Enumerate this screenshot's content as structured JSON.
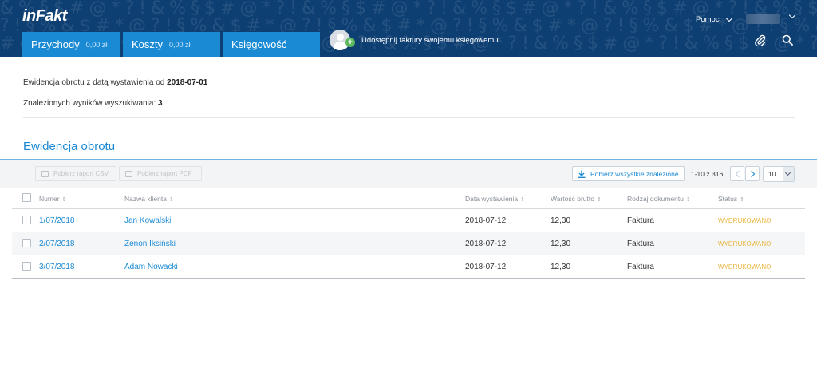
{
  "app": {
    "logo": "inFakt",
    "help_label": "Pomoc",
    "share_text": "Udostępnij faktury swojemu księgowemu"
  },
  "tabs": [
    {
      "label": "Przychody",
      "amount": "0,00 zł"
    },
    {
      "label": "Koszty",
      "amount": "0,00 zł"
    },
    {
      "label": "Księgowość",
      "amount": ""
    }
  ],
  "summary": {
    "filter_prefix": "Ewidencja obrotu z datą wystawienia od ",
    "filter_date": "2018-07-01",
    "results_prefix": "Znalezionych wyników wyszukiwania: ",
    "results_count": "3"
  },
  "section": {
    "title": "Ewidencja obrotu"
  },
  "toolbar": {
    "csv_label": "Pobierz raport CSV",
    "pdf_label": "Pobierz raport PDF",
    "download_all_label": "Pobierz wszystkie znalezione",
    "pager_text": "1-10 z 316",
    "per_page": "10"
  },
  "table": {
    "columns": [
      "Numer",
      "Nazwa klienta",
      "Data wystawienia",
      "Wartość brutto",
      "Rodzaj dokumentu",
      "Status"
    ],
    "rows": [
      {
        "number": "1/07/2018",
        "client": "Jan Kowalski",
        "date": "2018-07-12",
        "gross": "12,30",
        "doc_type": "Faktura",
        "status": "WYDRUKOWANO"
      },
      {
        "number": "2/07/2018",
        "client": "Zenon Iksiński",
        "date": "2018-07-12",
        "gross": "12,30",
        "doc_type": "Faktura",
        "status": "WYDRUKOWANO"
      },
      {
        "number": "3/07/2018",
        "client": "Adam Nowacki",
        "date": "2018-07-12",
        "gross": "12,30",
        "doc_type": "Faktura",
        "status": "WYDRUKOWANO"
      }
    ]
  },
  "colors": {
    "header_bg": "#0e3f73",
    "tab_bg": "#1a8ad4",
    "link": "#1a8ad4",
    "status_printed": "#e7b53c"
  },
  "icons": [
    "user-avatar-icon",
    "add-icon",
    "chevron-down-icon",
    "paperclip-icon",
    "search-icon",
    "download-icon",
    "chevron-left-icon",
    "chevron-right-icon",
    "calendar-icon",
    "sort-icon"
  ]
}
